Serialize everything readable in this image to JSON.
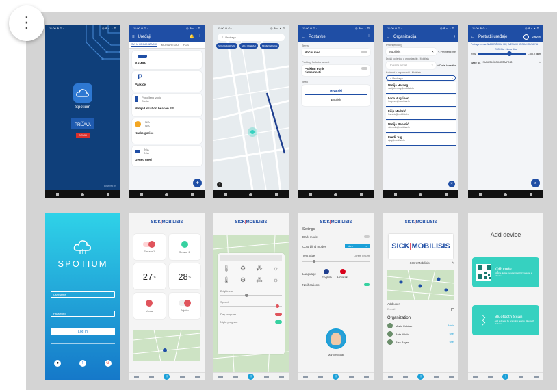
{
  "status_time": "11:00 ⊕ ⊙ ·",
  "status_icons": "◎ ⊕ ◐ ▲ ⊡",
  "splash": {
    "name": "Spotium",
    "env": "PRIJAVA",
    "badge": "DEMO",
    "powered": "powered by"
  },
  "devices": {
    "title": "Uređaji",
    "tabs": [
      "SVI U ORGANIZACIJI",
      "MOJI UREĐAJI",
      "POS"
    ],
    "items": [
      {
        "name": "RAMPA"
      },
      {
        "name": "Parkiće"
      },
      {
        "name": "Matija Location beacon ES",
        "meta": "Pogođeno vodio",
        "meta2": "Dosta"
      },
      {
        "name": "Krako gorice",
        "meta": "N/A",
        "meta2": "N/A"
      },
      {
        "name": "Gegec ured",
        "meta": "N/A",
        "meta2": "N/A"
      }
    ]
  },
  "map": {
    "search": "Pretraga",
    "chips": [
      "SVI U GRAĐEVINI",
      "MOJI UREĐAJI",
      "MOJE VERIZIJE"
    ]
  },
  "settings": {
    "title": "Postavke",
    "theme_label": "Tema",
    "dark_mode": "Noćni mod",
    "parking_label": "Parking funkcionalnost",
    "parking_value": "Parking Funk cionalnosti",
    "lang_label": "Jezik",
    "lang_selected": "Hrvatski",
    "lang_other": "English"
  },
  "org": {
    "title": "Organizacija",
    "section": "Promijeni org",
    "org_name": "Mobilisis",
    "rename": "Preimenuj ime",
    "add_label": "Dodaj korisnika u organizaciju - Mobilisis",
    "add_placeholder": "Unesite email",
    "add_button": "Dodaj korisnika",
    "users_label": "Korisnici u organizaciji - Mobilisis",
    "search": "Pretraga",
    "users": [
      {
        "name": "Matija Herceg",
        "email": "matija.herceg@mobilisis.hr"
      },
      {
        "name": "Ivica Vugrinec",
        "email": "ivugrinec@mobilisis.hr"
      },
      {
        "name": "Filip Meštrić",
        "email": "fmestric@mobilisis.hr"
      },
      {
        "name": "Matija Benotić",
        "email": "mbenotic@mobilisis.hr"
      },
      {
        "name": "Eredi Jug",
        "email": "ejug@mobilisis.hr"
      }
    ]
  },
  "search_devices": {
    "title": "Pretraži uređaje",
    "close": "Zatvori",
    "hint": "Pretraga prema: NUMERIČKOM IDU, IMENU ILI BROJU KONTAKTA",
    "rssi_label": "RSSI filtar: Nema filtra",
    "rssi_left": "RSSI",
    "rssi_right": "-100,0 dBm",
    "field_label": "Naziv uđ.",
    "field_value": "NUMERIČKOKONTAKTNO"
  },
  "login": {
    "brand": "SPOTIUM",
    "username": "Username",
    "password": "Password",
    "button": "Log In"
  },
  "dashboard": {
    "temps": [
      "27",
      "28"
    ],
    "unit": "°C",
    "labels": [
      "Senzor 1",
      "Senzor 2",
      "Vrata",
      "Svjetlo"
    ]
  },
  "control": {
    "sliders": [
      "Brightness",
      "Speed"
    ],
    "toggles": [
      "Day program",
      "Night program"
    ]
  },
  "settings2": {
    "title": "Settings",
    "dark_mode": "Dark mode",
    "colorblind": "Colorblind modes",
    "colorblind_value": "None",
    "text_size": "Text Size",
    "text_size_hint": "Lorem ipsum",
    "language": "Language",
    "lang_en": "English",
    "lang_hr": "Hrvatski",
    "notifications": "Notifications",
    "user": "Mario Kokčak"
  },
  "org2": {
    "name": "SICK Mobilisis",
    "add_user": "Add user",
    "email_placeholder": "E-mail",
    "section": "Organization",
    "members": [
      {
        "name": "Mario Kokčak",
        "role": "Admin"
      },
      {
        "name": "Ante Nikšić",
        "role": "User"
      },
      {
        "name": "Alex Bayer",
        "role": "User"
      }
    ]
  },
  "add_device": {
    "title": "Add device",
    "qr": "QR code",
    "qr_sub": "Add a device by scanning QR code on a device",
    "bt": "Bluetooth Scan",
    "bt_sub": "Add a device by scanning nearby Bluetooth devices"
  },
  "brand_sick": "SICK",
  "brand_mobilisis": "MOBILISIS",
  "colors": {
    "primary": "#1f4ea5",
    "accent": "#1aa0d8",
    "teal": "#36d1c0",
    "danger": "#e0545c",
    "splash_bg": "#0f3f7a"
  }
}
